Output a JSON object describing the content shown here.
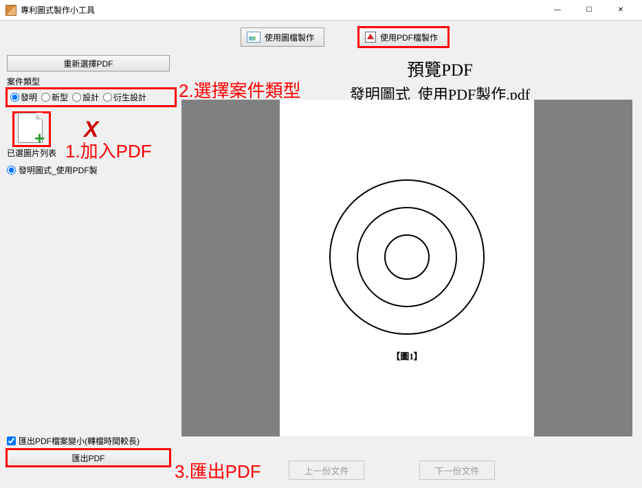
{
  "window": {
    "title": "專利圖式製作小工具"
  },
  "toolbar": {
    "use_image_label": "使用圖檔製作",
    "use_pdf_label": "使用PDF檔製作"
  },
  "left": {
    "reselect_label": "重新選擇PDF",
    "case_type_label": "案件類型",
    "radios": {
      "invention": "發明",
      "utility": "新型",
      "design": "設計",
      "derived": "衍生設計"
    },
    "list_label": "已選圖片列表",
    "file_item": "發明圖式_使用PDF製",
    "shrink_checkbox": "匯出PDF檔案變小(轉檔時間較長)",
    "export_label": "匯出PDF"
  },
  "preview": {
    "title": "預覽PDF",
    "filename": "發明圖式_使用PDF製作.pdf",
    "figure_label": "【圖1】"
  },
  "nav": {
    "prev": "上一份文件",
    "next": "下一份文件"
  },
  "annotations": {
    "a1": "1.加入PDF",
    "a2": "2.選擇案件類型",
    "a3": "3.匯出PDF"
  }
}
